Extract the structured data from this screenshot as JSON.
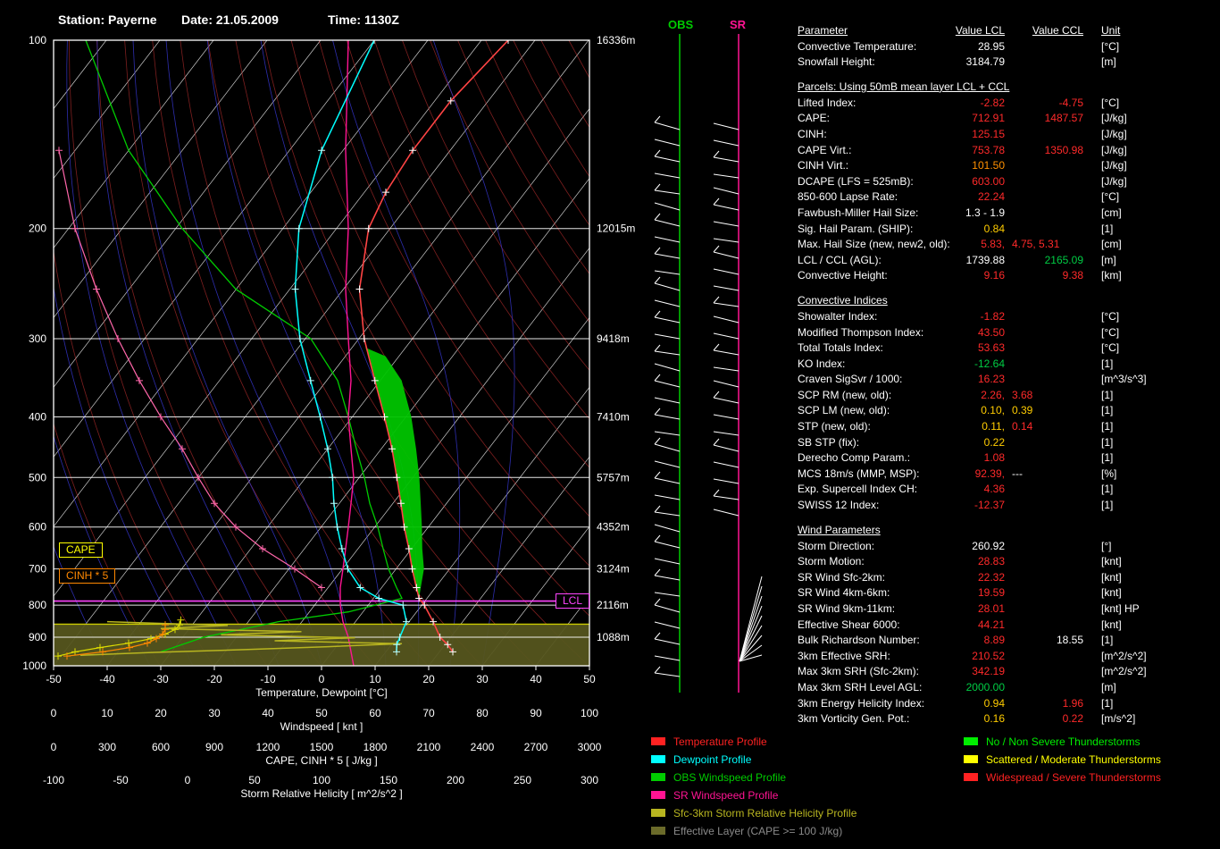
{
  "header": {
    "station": "Station: Payerne",
    "date": "Date: 21.05.2009",
    "time": "Time: 1130Z"
  },
  "wind_columns": {
    "obs_label": "OBS",
    "sr_label": "SR"
  },
  "chart_data": {
    "type": "skewt-sounding",
    "title": "Skew-T sounding Payerne 21.05.2009 1130Z",
    "pressure_ticks": [
      100,
      200,
      300,
      400,
      500,
      600,
      700,
      800,
      900,
      1000
    ],
    "height_labels": [
      {
        "p": 100,
        "label": "16336m"
      },
      {
        "p": 200,
        "label": "12015m"
      },
      {
        "p": 300,
        "label": "9418m"
      },
      {
        "p": 400,
        "label": "7410m"
      },
      {
        "p": 500,
        "label": "5757m"
      },
      {
        "p": 600,
        "label": "4352m"
      },
      {
        "p": 700,
        "label": "3124m"
      },
      {
        "p": 800,
        "label": "2116m"
      },
      {
        "p": 900,
        "label": "1088m"
      }
    ],
    "axes": [
      {
        "name": "temperature",
        "title": "Temperature, Dewpoint  [°C]",
        "ticks": [
          -50,
          -40,
          -30,
          -20,
          -10,
          0,
          10,
          20,
          30,
          40,
          50
        ]
      },
      {
        "name": "windspeed",
        "title": "Windspeed  [ knt ]",
        "ticks": [
          0,
          10,
          20,
          30,
          40,
          50,
          60,
          70,
          80,
          90,
          100
        ]
      },
      {
        "name": "cape",
        "title": "CAPE, CINH * 5  [ J/kg ]",
        "ticks": [
          0,
          300,
          600,
          900,
          1200,
          1500,
          1800,
          2100,
          2400,
          2700,
          3000
        ]
      },
      {
        "name": "srh",
        "title": "Storm Relative Helicity  [ m^2/s^2 ]",
        "ticks": [
          -100,
          -50,
          0,
          50,
          100,
          150,
          200,
          250,
          300
        ]
      }
    ],
    "annotations": [
      {
        "label": "CAPE",
        "color": "#ffff00"
      },
      {
        "label": "CINH * 5",
        "color": "#ff8800"
      },
      {
        "label": "LCL",
        "color": "#ff44ff"
      }
    ],
    "temperature_profile": [
      [
        100,
        -55
      ],
      [
        125,
        -57
      ],
      [
        150,
        -57
      ],
      [
        175,
        -56
      ],
      [
        200,
        -54
      ],
      [
        250,
        -47
      ],
      [
        300,
        -39
      ],
      [
        350,
        -31
      ],
      [
        400,
        -24
      ],
      [
        450,
        -18
      ],
      [
        500,
        -13
      ],
      [
        550,
        -8.5
      ],
      [
        600,
        -4.5
      ],
      [
        650,
        -0.5
      ],
      [
        700,
        3
      ],
      [
        750,
        6.5
      ],
      [
        780,
        8.5
      ],
      [
        800,
        10.5
      ],
      [
        850,
        14.5
      ],
      [
        900,
        18
      ],
      [
        925,
        20.5
      ],
      [
        950,
        22.5
      ]
    ],
    "dewpoint_profile": [
      [
        100,
        -80
      ],
      [
        150,
        -74
      ],
      [
        200,
        -67
      ],
      [
        250,
        -59
      ],
      [
        300,
        -51
      ],
      [
        350,
        -43
      ],
      [
        400,
        -36
      ],
      [
        450,
        -30
      ],
      [
        500,
        -25
      ],
      [
        550,
        -21
      ],
      [
        600,
        -17
      ],
      [
        650,
        -13
      ],
      [
        700,
        -9
      ],
      [
        750,
        -4
      ],
      [
        780,
        1
      ],
      [
        800,
        6.5
      ],
      [
        850,
        9.5
      ],
      [
        900,
        10.5
      ],
      [
        925,
        11
      ],
      [
        950,
        12
      ]
    ],
    "cape_area": [
      [
        780,
        8.5,
        8.5
      ],
      [
        750,
        6.5,
        7.3
      ],
      [
        700,
        3,
        5.2
      ],
      [
        650,
        -0.5,
        2
      ],
      [
        600,
        -4.5,
        -1.2
      ],
      [
        550,
        -8.5,
        -4.8
      ],
      [
        500,
        -13,
        -8.8
      ],
      [
        450,
        -18,
        -13.5
      ],
      [
        400,
        -24,
        -19
      ],
      [
        350,
        -31,
        -26
      ],
      [
        320,
        -35.5,
        -32.5
      ],
      [
        310,
        -37.5,
        -37.5
      ]
    ],
    "sr_windspeed_profile": [
      [
        100,
        55
      ],
      [
        150,
        54.5
      ],
      [
        200,
        55
      ],
      [
        250,
        54.5
      ],
      [
        300,
        55
      ],
      [
        350,
        55.5
      ],
      [
        400,
        55
      ],
      [
        450,
        55.5
      ],
      [
        500,
        56
      ],
      [
        550,
        55.5
      ],
      [
        600,
        55
      ],
      [
        650,
        54.5
      ],
      [
        700,
        54
      ],
      [
        750,
        53.5
      ],
      [
        800,
        53.5
      ],
      [
        850,
        54
      ],
      [
        900,
        55
      ],
      [
        950,
        55.5
      ],
      [
        1000,
        56
      ]
    ],
    "obs_windspeed_profile": [
      [
        100,
        6
      ],
      [
        150,
        14
      ],
      [
        200,
        24
      ],
      [
        250,
        34
      ],
      [
        300,
        48
      ],
      [
        350,
        53
      ],
      [
        400,
        55
      ],
      [
        450,
        56.5
      ],
      [
        500,
        58
      ],
      [
        550,
        59
      ],
      [
        600,
        60.5
      ],
      [
        650,
        61.5
      ],
      [
        700,
        62.5
      ],
      [
        750,
        64
      ],
      [
        780,
        65
      ],
      [
        820,
        55
      ],
      [
        850,
        42
      ],
      [
        900,
        28
      ],
      [
        950,
        20
      ]
    ],
    "storm_motion_profile": [
      [
        150,
        1
      ],
      [
        200,
        4
      ],
      [
        250,
        8
      ],
      [
        300,
        12
      ],
      [
        350,
        16
      ],
      [
        400,
        20
      ],
      [
        450,
        24
      ],
      [
        500,
        27
      ],
      [
        550,
        30
      ],
      [
        600,
        34
      ],
      [
        650,
        39
      ],
      [
        700,
        45
      ],
      [
        750,
        50
      ]
    ],
    "srh_profile": [
      [
        850,
        -60
      ],
      [
        862,
        30
      ],
      [
        872,
        -20
      ],
      [
        882,
        85
      ],
      [
        892,
        25
      ],
      [
        902,
        125
      ],
      [
        912,
        65
      ],
      [
        922,
        160
      ],
      [
        932,
        105
      ],
      [
        942,
        45
      ],
      [
        952,
        -25
      ],
      [
        962,
        -80
      ]
    ],
    "cape_profile": [
      [
        965,
        25
      ],
      [
        950,
        120
      ],
      [
        935,
        260
      ],
      [
        920,
        420
      ],
      [
        905,
        545
      ],
      [
        890,
        625
      ],
      [
        875,
        680
      ],
      [
        860,
        705
      ],
      [
        845,
        712
      ]
    ],
    "cinh_profile": [
      [
        965,
        15
      ],
      [
        950,
        55
      ],
      [
        935,
        85
      ],
      [
        920,
        105
      ],
      [
        905,
        115
      ],
      [
        890,
        122
      ],
      [
        875,
        125
      ],
      [
        860,
        125
      ]
    ],
    "effective_layer": {
      "top_p": 858,
      "bottom_p": 1000
    },
    "lcl_line_p": 788,
    "srh_level_line_p": 858,
    "colors": {
      "temperature": "#ff4444",
      "dewpoint": "#00ffff",
      "obs_wind": "#00cc00",
      "sr_wind": "#ff1493",
      "srh": "#b8b520",
      "effective_layer": "#55551e",
      "cape_fill": "#00c400",
      "cape_curve": "#dddd00",
      "cinh_curve": "#ff8800",
      "isotherms": "#ffffff",
      "dry_adiabats": "#c03030",
      "moist_adiabats": "#3838d8",
      "lcl_line": "#ff44ff",
      "srh_level_line": "#cccc00"
    }
  },
  "table": {
    "headers": {
      "parameter": "Parameter",
      "value_lcl": "Value LCL",
      "value_ccl": "Value CCL",
      "unit": "Unit"
    },
    "rows": [
      {
        "t": "row",
        "label": "Convective Temperature:",
        "lcl": "28.95",
        "lclc": "w",
        "unit": "[°C]"
      },
      {
        "t": "row",
        "label": "Snowfall Height:",
        "lcl": "3184.79",
        "lclc": "w",
        "unit": "[m]"
      },
      {
        "t": "sec",
        "label": "Parcels: Using 50mB mean layer LCL + CCL"
      },
      {
        "t": "row",
        "label": "Lifted Index:",
        "lcl": "-2.82",
        "lclc": "r",
        "ccl": "-4.75",
        "cclc": "r",
        "unit": "[°C]"
      },
      {
        "t": "row",
        "label": "CAPE:",
        "lcl": "712.91",
        "lclc": "r",
        "ccl": "1487.57",
        "cclc": "r",
        "unit": "[J/kg]"
      },
      {
        "t": "row",
        "label": "CINH:",
        "lcl": "125.15",
        "lclc": "r",
        "unit": "[J/kg]"
      },
      {
        "t": "row",
        "label": "CAPE Virt.:",
        "lcl": "753.78",
        "lclc": "r",
        "ccl": "1350.98",
        "cclc": "r",
        "unit": "[J/kg]"
      },
      {
        "t": "row",
        "label": "CINH Virt.:",
        "lcl": "101.50",
        "lclc": "o",
        "unit": "[J/kg]"
      },
      {
        "t": "row",
        "label": "DCAPE (LFS = 525mB):",
        "lcl": "603.00",
        "lclc": "r",
        "unit": "[J/kg]"
      },
      {
        "t": "row",
        "label": "850-600 Lapse Rate:",
        "lcl": "22.24",
        "lclc": "r",
        "unit": "[°C]"
      },
      {
        "t": "row",
        "label": "Fawbush-Miller Hail Size:",
        "lcl": "1.3 - 1.9",
        "lclc": "w",
        "unit": "[cm]"
      },
      {
        "t": "row",
        "label": "Sig. Hail Param. (SHIP):",
        "lcl": "0.84",
        "lclc": "y",
        "unit": "[1]"
      },
      {
        "t": "row",
        "label": "Max. Hail Size (new, new2, old):",
        "lcl": "5.83,",
        "lclc": "r",
        "ccl": "4.75, 5.31",
        "cclc": "r",
        "ccla": "l",
        "unit": "[cm]"
      },
      {
        "t": "row",
        "label": "LCL / CCL (AGL):",
        "lcl": "1739.88",
        "lclc": "w",
        "ccl": "2165.09",
        "cclc": "g",
        "unit": "[m]"
      },
      {
        "t": "row",
        "label": "Convective Height:",
        "lcl": "9.16",
        "lclc": "r",
        "ccl": "9.38",
        "cclc": "r",
        "unit": "[km]"
      },
      {
        "t": "sec",
        "label": "Convective Indices"
      },
      {
        "t": "row",
        "label": "Showalter Index:",
        "lcl": "-1.82",
        "lclc": "r",
        "unit": "[°C]"
      },
      {
        "t": "row",
        "label": "Modified Thompson Index:",
        "lcl": "43.50",
        "lclc": "r",
        "unit": "[°C]"
      },
      {
        "t": "row",
        "label": "Total Totals Index:",
        "lcl": "53.63",
        "lclc": "r",
        "unit": "[°C]"
      },
      {
        "t": "row",
        "label": "KO Index:",
        "lcl": "-12.64",
        "lclc": "g",
        "unit": "[1]"
      },
      {
        "t": "row",
        "label": "Craven SigSvr / 1000:",
        "lcl": "16.23",
        "lclc": "r",
        "unit": "[m^3/s^3]"
      },
      {
        "t": "row",
        "label": "SCP RM (new, old):",
        "lcl": "2.26,",
        "lclc": "r",
        "ccl": "3.68",
        "cclc": "r",
        "ccla": "l",
        "unit": "[1]"
      },
      {
        "t": "row",
        "label": "SCP LM (new, old):",
        "lcl": "0.10,",
        "lclc": "y",
        "ccl": "0.39",
        "cclc": "y",
        "ccla": "l",
        "unit": "[1]"
      },
      {
        "t": "row",
        "label": "STP (new, old):",
        "lcl": "0.11,",
        "lclc": "y",
        "ccl": "0.14",
        "cclc": "r",
        "ccla": "l",
        "unit": "[1]"
      },
      {
        "t": "row",
        "label": "SB STP (fix):",
        "lcl": "0.22",
        "lclc": "y",
        "unit": "[1]"
      },
      {
        "t": "row",
        "label": "Derecho Comp Param.:",
        "lcl": "1.08",
        "lclc": "r",
        "unit": "[1]"
      },
      {
        "t": "row",
        "label": "MCS 18m/s (MMP, MSP):",
        "lcl": "92.39,",
        "lclc": "r",
        "ccl": "---",
        "cclc": "w",
        "ccla": "l",
        "unit": "[%]"
      },
      {
        "t": "row",
        "label": "Exp. Supercell Index CH:",
        "lcl": "4.36",
        "lclc": "r",
        "unit": "[1]"
      },
      {
        "t": "row",
        "label": "SWISS 12 Index:",
        "lcl": "-12.37",
        "lclc": "r",
        "unit": "[1]"
      },
      {
        "t": "sec",
        "label": "Wind Parameters"
      },
      {
        "t": "row",
        "label": "Storm Direction:",
        "lcl": "260.92",
        "lclc": "w",
        "unit": "[°]"
      },
      {
        "t": "row",
        "label": "Storm Motion:",
        "lcl": "28.83",
        "lclc": "r",
        "unit": "[knt]"
      },
      {
        "t": "row",
        "label": "SR Wind Sfc-2km:",
        "lcl": "22.32",
        "lclc": "r",
        "unit": "[knt]"
      },
      {
        "t": "row",
        "label": "SR Wind 4km-6km:",
        "lcl": "19.59",
        "lclc": "r",
        "unit": "[knt]"
      },
      {
        "t": "row",
        "label": "SR Wind 9km-11km:",
        "lcl": "28.01",
        "lclc": "r",
        "unit": "[knt] HP"
      },
      {
        "t": "row",
        "label": "Effective Shear 6000:",
        "lcl": "44.21",
        "lclc": "r",
        "unit": "[knt]"
      },
      {
        "t": "row",
        "label": "Bulk Richardson Number:",
        "lcl": "8.89",
        "lclc": "r",
        "ccl": "18.55",
        "cclc": "w",
        "unit": "[1]"
      },
      {
        "t": "row",
        "label": "3km Effective SRH:",
        "lcl": "210.52",
        "lclc": "r",
        "unit": "[m^2/s^2]"
      },
      {
        "t": "row",
        "label": "Max 3km SRH (Sfc-2km):",
        "lcl": "342.19",
        "lclc": "r",
        "unit": "[m^2/s^2]"
      },
      {
        "t": "row",
        "label": "Max 3km SRH Level AGL:",
        "lcl": "2000.00",
        "lclc": "g",
        "unit": "[m]"
      },
      {
        "t": "row",
        "label": "3km Energy Helicity Index:",
        "lcl": "0.94",
        "lclc": "y",
        "ccl": "1.96",
        "cclc": "r",
        "unit": "[1]"
      },
      {
        "t": "row",
        "label": "3km Vorticity Gen. Pot.:",
        "lcl": "0.16",
        "lclc": "y",
        "ccl": "0.22",
        "cclc": "r",
        "unit": "[m/s^2]"
      }
    ]
  },
  "legend_profiles": [
    {
      "label": "Temperature Profile",
      "color": "#ff2222"
    },
    {
      "label": "Dewpoint Profile",
      "color": "#00ffff"
    },
    {
      "label": "OBS Windspeed Profile",
      "color": "#00cc00"
    },
    {
      "label": "SR Windspeed Profile",
      "color": "#ff1493"
    },
    {
      "label": "Sfc-3km Storm Relative Helicity Profile",
      "color": "#b8b520"
    },
    {
      "label": "Effective Layer (CAPE >= 100 J/kg)",
      "color": "#6b6b2a",
      "text_color": "#8a8a8a"
    }
  ],
  "legend_severity": [
    {
      "label": "No / Non Severe Thunderstorms",
      "color": "#00ee00"
    },
    {
      "label": "Scattered / Moderate Thunderstorms",
      "color": "#ffff00"
    },
    {
      "label": "Widespread / Severe Thunderstorms",
      "color": "#ff2222"
    }
  ]
}
